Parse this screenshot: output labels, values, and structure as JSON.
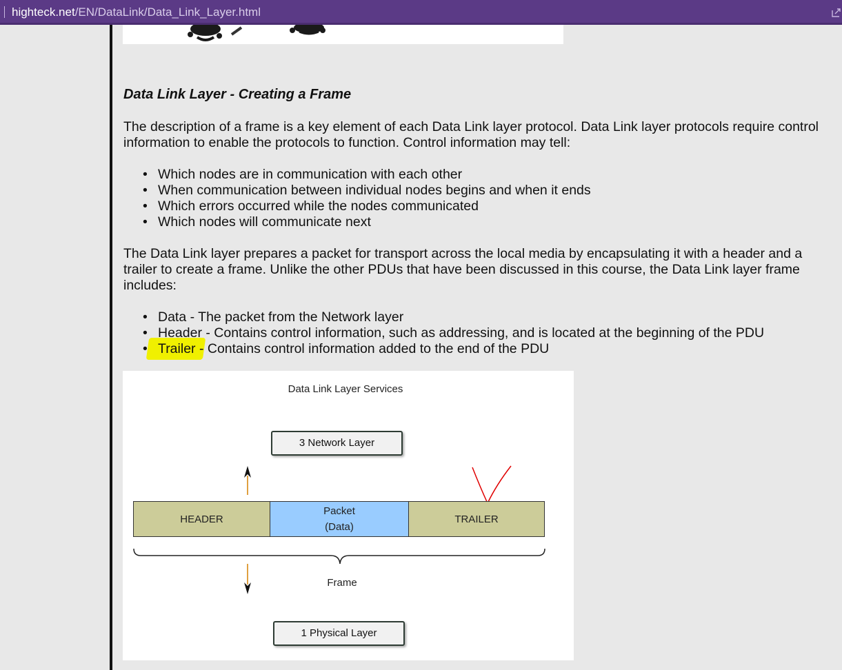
{
  "browser": {
    "url_host": "highteck.net",
    "url_path": "/EN/DataLink/Data_Link_Layer.html"
  },
  "article": {
    "section_title": "Data Link Layer - Creating a Frame",
    "para1": "The description of a frame is a key element of each Data Link layer protocol. Data Link layer protocols require control information to enable the protocols to function. Control information may tell:",
    "list1": [
      "Which nodes are in communication with each other",
      "When communication between individual nodes begins and when it ends",
      "Which errors occurred while the nodes communicated",
      "Which nodes will communicate next"
    ],
    "para2": "The Data Link layer prepares a packet for transport across the local media by encapsulating it with a header and a trailer to create a frame. Unlike the other PDUs that have been discussed in this course, the Data Link layer frame includes:",
    "list2": [
      "Data - The packet from the Network layer",
      "Header - Contains control information, such as addressing, and is located at the beginning of the PDU",
      "Trailer - Contains control information added to the end of the PDU"
    ]
  },
  "diagram": {
    "title": "Data Link Layer Services",
    "network_layer": "3 Network Layer",
    "physical_layer": "1 Physical Layer",
    "header": "HEADER",
    "packet_line1": "Packet",
    "packet_line2": "(Data)",
    "trailer": "TRAILER",
    "frame": "Frame"
  },
  "colors": {
    "addressbar": "#5b3a86",
    "highlight": "#f0f000",
    "header_trailer_fill": "#cccc99",
    "packet_fill": "#99ccff",
    "annotation_red": "#e00000"
  }
}
